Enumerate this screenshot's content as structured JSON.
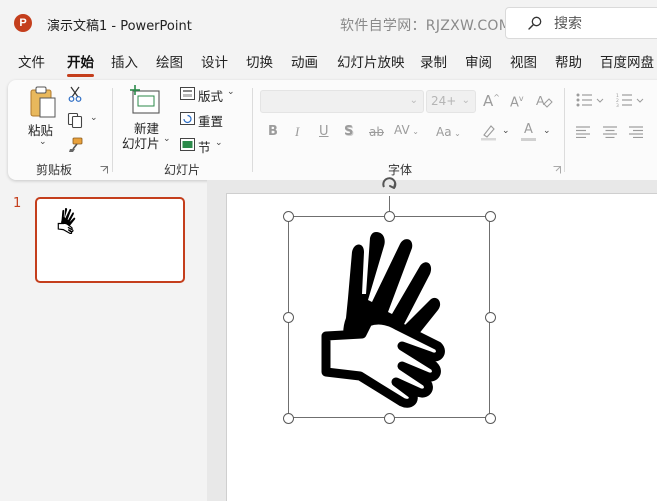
{
  "window": {
    "title": "演示文稿1  -  PowerPoint",
    "watermark": "软件自学网：RJZXW.COM",
    "search_placeholder": "搜索",
    "logo_letter": "P",
    "accent": "#c43e1c"
  },
  "tabs": [
    {
      "label": "文件",
      "active": false
    },
    {
      "label": "开始",
      "active": true
    },
    {
      "label": "插入",
      "active": false
    },
    {
      "label": "绘图",
      "active": false
    },
    {
      "label": "设计",
      "active": false
    },
    {
      "label": "切换",
      "active": false
    },
    {
      "label": "动画",
      "active": false
    },
    {
      "label": "幻灯片放映",
      "active": false
    },
    {
      "label": "录制",
      "active": false
    },
    {
      "label": "审阅",
      "active": false
    },
    {
      "label": "视图",
      "active": false
    },
    {
      "label": "帮助",
      "active": false
    },
    {
      "label": "百度网盘",
      "active": false
    }
  ],
  "ribbon": {
    "clipboard": {
      "group_label": "剪贴板",
      "paste_label": "粘贴",
      "icons": [
        "clipboard-icon",
        "scissors-icon",
        "copy-icon",
        "format-painter-icon"
      ]
    },
    "slides": {
      "group_label": "幻灯片",
      "new_slide_line1": "新建",
      "new_slide_line2": "幻灯片",
      "layout_label": "版式",
      "reset_label": "重置",
      "section_label": "节"
    },
    "font": {
      "group_label": "字体",
      "font_name_value": "",
      "font_size_value": "24+",
      "bold": "B",
      "italic": "I",
      "underline": "U",
      "shadow": "S",
      "strikethrough": "ab",
      "char_spacing": "AV",
      "change_case": "Aa",
      "increase_size": "A",
      "decrease_size": "A",
      "font_color": "A"
    }
  },
  "slides_panel": {
    "slide_number": "1",
    "selected_index": 0
  },
  "canvas": {
    "object_icon": "sign-language-hands-icon",
    "selected": true
  }
}
